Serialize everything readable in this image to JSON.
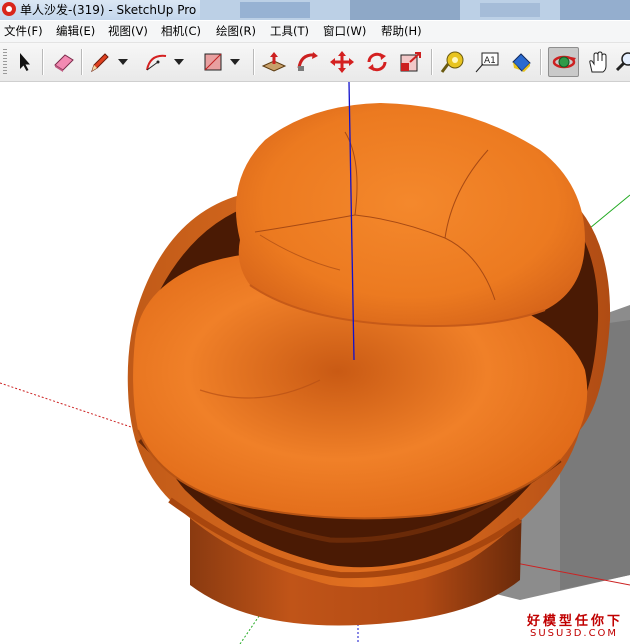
{
  "window": {
    "title": "单人沙发-(319) - SketchUp Pro",
    "app_icon": "sketchup-logo-icon"
  },
  "menu": {
    "items": [
      {
        "label": "文件(F)"
      },
      {
        "label": "编辑(E)"
      },
      {
        "label": "视图(V)"
      },
      {
        "label": "相机(C)"
      },
      {
        "label": "绘图(R)"
      },
      {
        "label": "工具(T)"
      },
      {
        "label": "窗口(W)"
      },
      {
        "label": "帮助(H)"
      }
    ]
  },
  "toolbar": {
    "tools": [
      {
        "name": "select-tool",
        "icon": "arrow-cursor-icon"
      },
      {
        "name": "eraser-tool",
        "icon": "eraser-icon"
      },
      {
        "name": "line-tool",
        "icon": "pencil-icon"
      },
      {
        "name": "arc-tool",
        "icon": "arc-icon"
      },
      {
        "name": "rectangle-tool",
        "icon": "rectangle-icon"
      },
      {
        "name": "push-pull-tool",
        "icon": "push-pull-icon"
      },
      {
        "name": "follow-me-tool",
        "icon": "follow-me-icon"
      },
      {
        "name": "move-tool",
        "icon": "move-arrows-icon"
      },
      {
        "name": "rotate-tool",
        "icon": "rotate-icon"
      },
      {
        "name": "scale-tool",
        "icon": "scale-icon"
      },
      {
        "name": "tape-measure-tool",
        "icon": "tape-measure-icon"
      },
      {
        "name": "text-tool",
        "icon": "text-label-icon"
      },
      {
        "name": "paint-bucket-tool",
        "icon": "paint-bucket-icon"
      },
      {
        "name": "orbit-tool",
        "icon": "orbit-icon",
        "active": true
      },
      {
        "name": "pan-tool",
        "icon": "hand-icon"
      },
      {
        "name": "zoom-tool",
        "icon": "magnifier-icon"
      }
    ],
    "text_tool_glyph": "A1"
  },
  "viewport": {
    "model": "single-sofa-chair",
    "colors": {
      "sofa_orange": "#e8701c",
      "sofa_dark": "#5a2408",
      "base_brown": "#b84e14",
      "blue_axis": "#1010cc",
      "green_axis": "#22aa22",
      "red_axis": "#cc2222",
      "shadow": "#8c8c8c"
    }
  },
  "watermark": {
    "line1": "好模型任你下",
    "line2": "SUSU3D.COM"
  }
}
